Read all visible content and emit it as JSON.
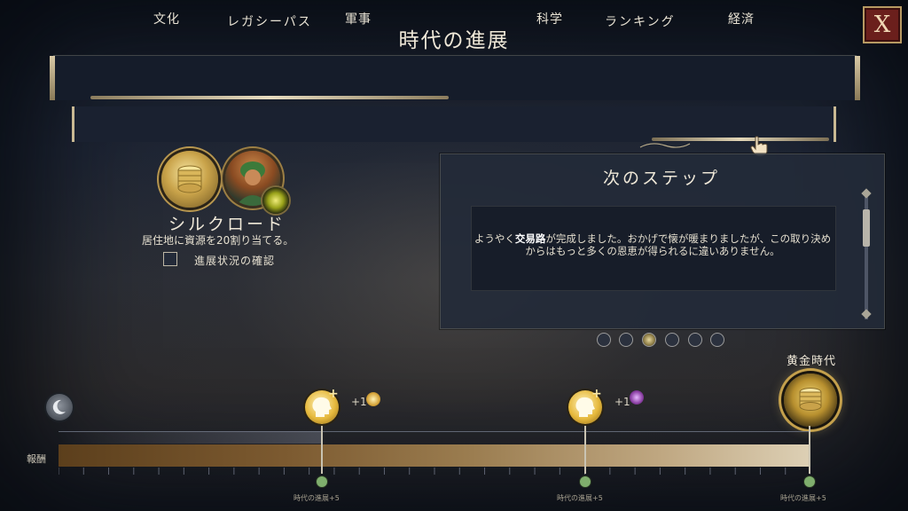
{
  "window": {
    "title": "時代の進展",
    "close_label": "X"
  },
  "main_tabs": [
    {
      "label": "レガシーパス",
      "selected": true
    },
    {
      "label": "ランキング",
      "selected": false
    }
  ],
  "sub_tabs": [
    {
      "label": "文化",
      "selected": false
    },
    {
      "label": "軍事",
      "selected": false
    },
    {
      "label": "科学",
      "selected": false
    },
    {
      "label": "経済",
      "selected": true
    }
  ],
  "quest": {
    "name": "シルクロード",
    "description": "居住地に資源を20割り当てる。",
    "checkbox_label": "進展状況の確認",
    "checked": false
  },
  "next_step": {
    "title": "次のステップ",
    "text_before": "ようやく",
    "text_highlight": "交易路",
    "text_after": "が完成しました。おかげで懐が暖まりましたが、この取り決めからはもっと多くの恩恵が得られるに違いありません。",
    "page_count": 6,
    "current_page": 3
  },
  "timeline": {
    "reward_label": "報酬",
    "final_age_label": "黄金時代",
    "milestones": [
      {
        "reward_text": "+1",
        "footnote": "時代の進展+5"
      },
      {
        "reward_text": "+1",
        "footnote": "時代の進展+5"
      },
      {
        "reward_text": "",
        "footnote": "時代の進展+5"
      }
    ]
  },
  "colors": {
    "accent_gold": "#c4a04c",
    "close_red": "#6b1f1c",
    "check_green": "#7fae6d"
  }
}
